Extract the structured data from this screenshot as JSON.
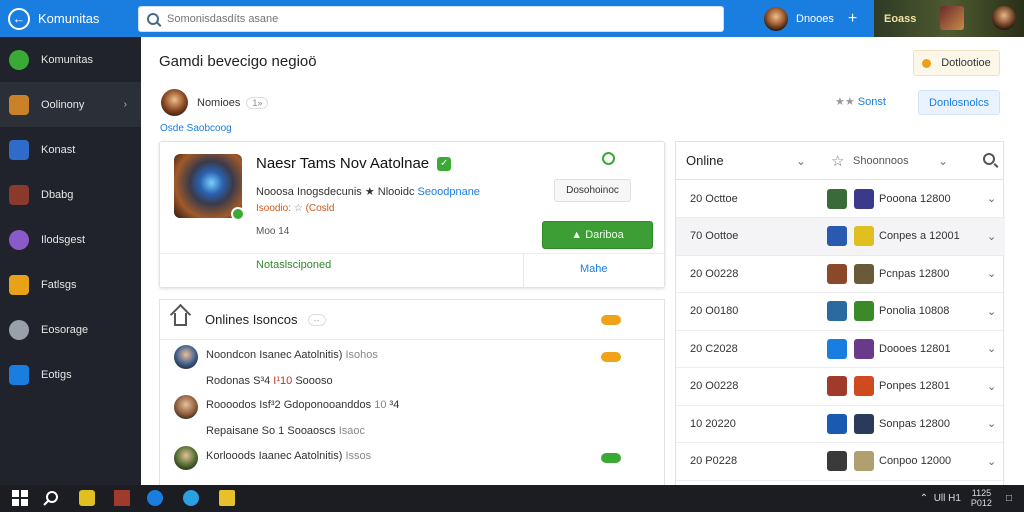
{
  "topbar": {
    "title": "Komunitas",
    "search_placeholder": "Somonisdasdíts asane",
    "user_name": "Dnooes",
    "game_tag": "Eoass"
  },
  "sidebar": {
    "items": [
      {
        "label": "Komunitas",
        "icon": "community-icon",
        "color": "#3aaa35"
      },
      {
        "label": "Oolinony",
        "icon": "game-icon",
        "color": "#c9822a",
        "chevron": true
      },
      {
        "label": "Konast",
        "icon": "game-icon",
        "color": "#2f6cc9"
      },
      {
        "label": "Dbabg",
        "icon": "game-icon",
        "color": "#8a3a2a"
      },
      {
        "label": "Ilodsgest",
        "icon": "game-icon",
        "color": "#8a5ac9"
      },
      {
        "label": "Fatlsgs",
        "icon": "warning-icon",
        "color": "#e7a21a"
      },
      {
        "label": "Eosorage",
        "icon": "settings-icon",
        "color": "#9aa0aa"
      },
      {
        "label": "Eotigs",
        "icon": "monitor-icon",
        "color": "#1a7ee0"
      }
    ]
  },
  "main": {
    "title": "Gamdi bevecigo negioö",
    "follow_label": "Dotlootioe",
    "profile_name": "Nomioes",
    "profile_tag": "1»",
    "stars_label": "Sonst",
    "recommend_label": "Donlosnolcs",
    "sublink": "Osde Saobcoog"
  },
  "card": {
    "title": "Naesr Tams Nov Aatolnae",
    "desc_part1": "Nooosa Inogsdecunis",
    "desc_part2": "Nlooidc",
    "desc_blue": "Seoodpnane",
    "meta_main": "Isoodio:",
    "meta_gray": "☆",
    "meta_extra": "(Cosld",
    "small": "Moo 14",
    "status": "Notaslsciponed",
    "detail_label": "Dosohoinoc",
    "play_label": "Dariboa",
    "more_label": "Mahe"
  },
  "online_section": {
    "title": "Onlines Isoncos",
    "count": "··"
  },
  "feed": [
    {
      "name": "Noondcon",
      "text": "Isanec Aatolnitis)",
      "g": "Isohos",
      "pill": "#f0a318"
    },
    {
      "name": "Rodonas",
      "text": "S³4",
      "r": "I¹10",
      "t2": "Soooso",
      "avatarless": true
    },
    {
      "name": "Roooodos",
      "text": "Isf³2",
      "t2": "Gdoponooanddos",
      "g": "10",
      "extra": "³4"
    },
    {
      "name": "Repaisane",
      "text": "So 1",
      "t2": "Sooaoscs",
      "g": "Isaoc",
      "avatarless": true
    },
    {
      "name": "Korlooods",
      "text": "Iaanec Aatolnitis)",
      "g": "Issos",
      "pill": "#3aaa35"
    }
  ],
  "right_panel": {
    "filter_label": "Online",
    "sort_label": "Shoonnoos",
    "rows": [
      {
        "date": "20 Octtoe",
        "value": "Pooona 12800",
        "c1": "#3a6a3a",
        "c2": "#3a3a8a"
      },
      {
        "date": "70 Oottoe",
        "value": "Conpes a 12001",
        "c1": "#2a5ab0",
        "c2": "#e0c020"
      },
      {
        "date": "20 O0228",
        "value": "Pcnpas 12800",
        "c1": "#8a4a2a",
        "c2": "#6a5a3a"
      },
      {
        "date": "20 O0180",
        "value": "Ponolia 10808",
        "c1": "#2a6aa0",
        "c2": "#3a8a2a"
      },
      {
        "date": "20 C2028",
        "value": "Doooes 12801",
        "c1": "#1a7ee0",
        "c2": "#6a3a8a"
      },
      {
        "date": "20 O0228",
        "value": "Ponpes 12801",
        "c1": "#a03a2a",
        "c2": "#d04a20"
      },
      {
        "date": "10 20220",
        "value": "Sonpas 12800",
        "c1": "#1a5ab0",
        "c2": "#2a3a5a"
      },
      {
        "date": "20 P0228",
        "value": "Conpoo 12000",
        "c1": "#3a3a3a",
        "c2": "#b0a070"
      }
    ]
  },
  "taskbar": {
    "time": "1125\nP012",
    "tray_text": "Ull H1"
  }
}
